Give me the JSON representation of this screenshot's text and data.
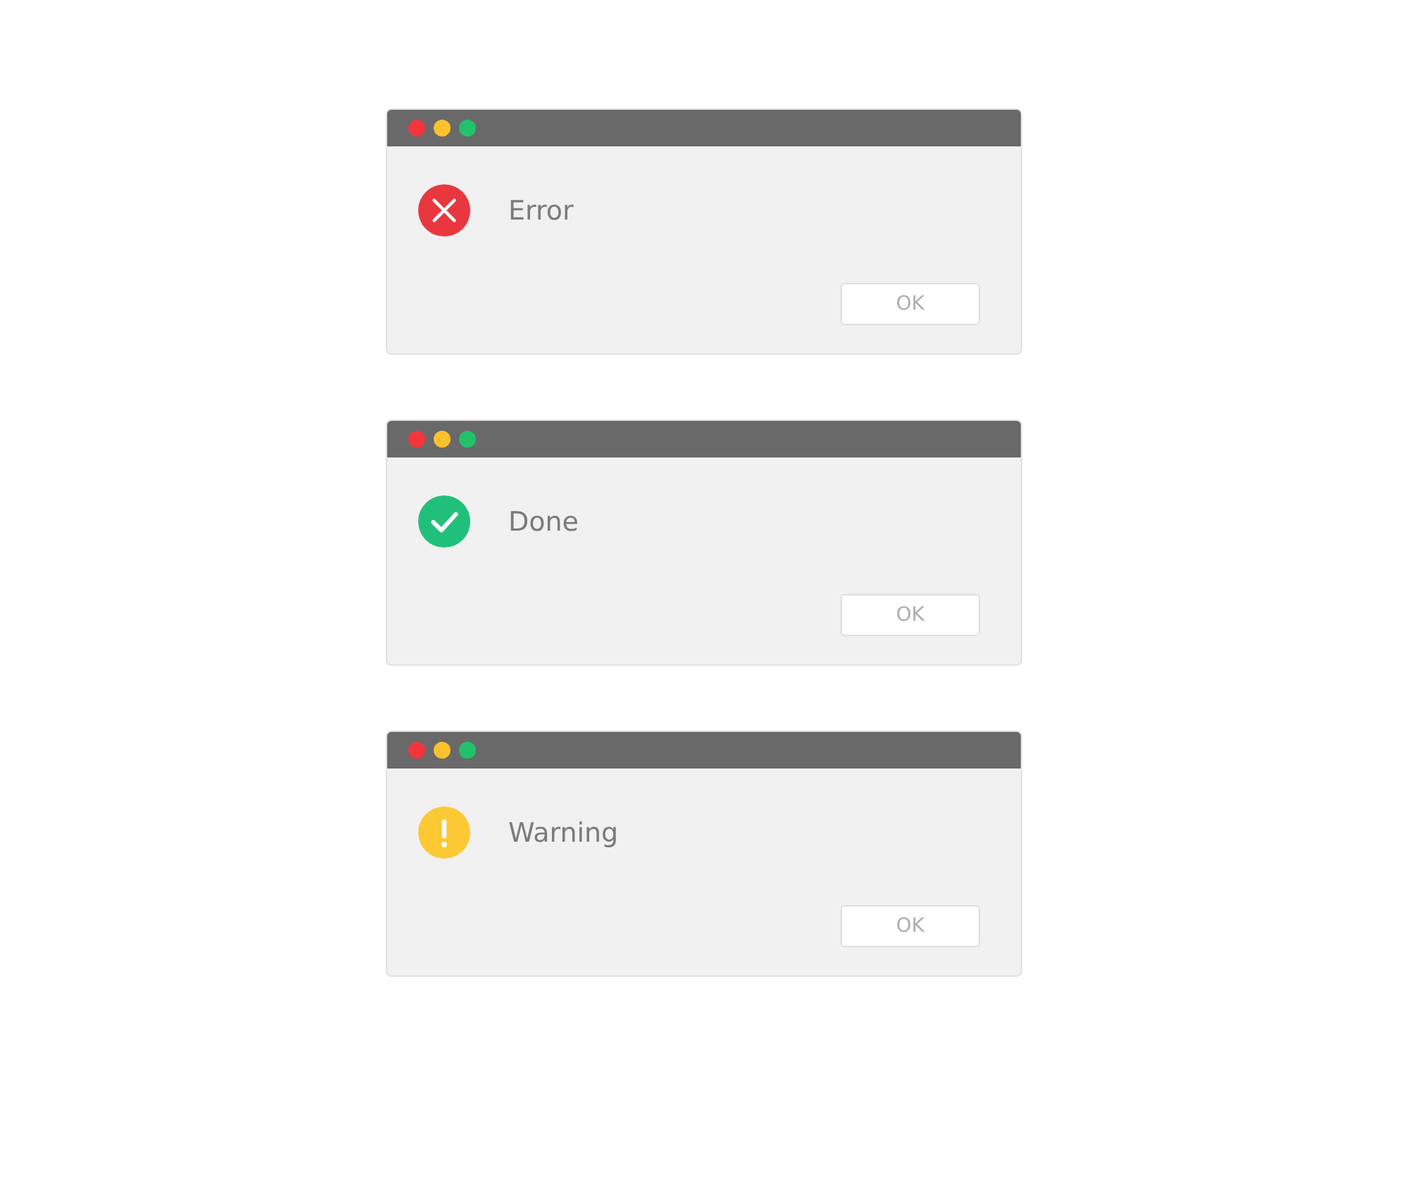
{
  "dialogs": [
    {
      "kind": "error",
      "message": "Error",
      "button": "OK"
    },
    {
      "kind": "success",
      "message": "Done",
      "button": "OK"
    },
    {
      "kind": "warning",
      "message": "Warning",
      "button": "OK"
    }
  ]
}
